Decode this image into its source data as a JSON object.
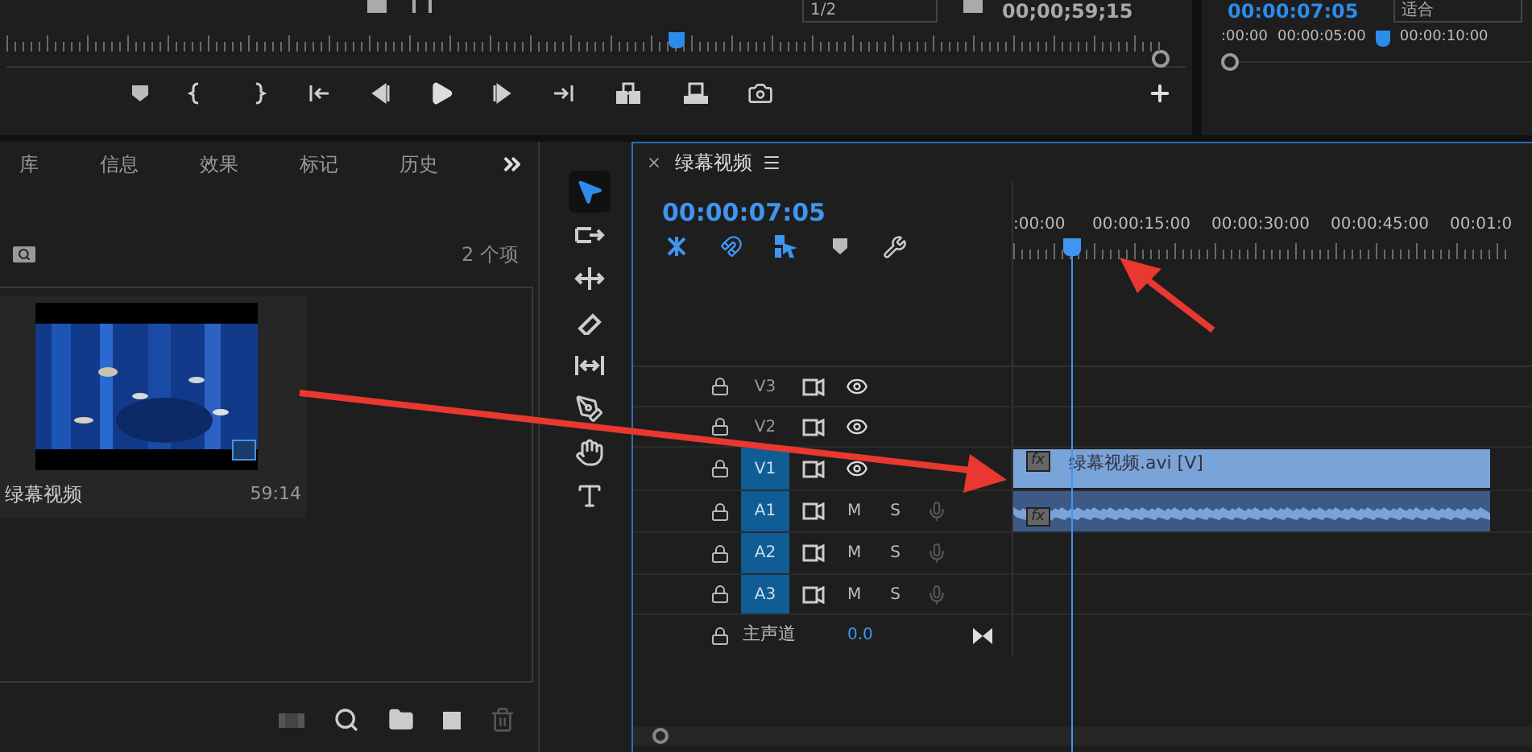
{
  "program_monitor": {
    "scale_dropdown": "1/2",
    "timecode": "00;00;59;15"
  },
  "source_monitor": {
    "timecode": "00:00:07:05",
    "fit_dropdown": "适合",
    "ruler_labels": [
      ":00:00",
      "00:00:05:00",
      "00:00:10:00"
    ]
  },
  "project_panel": {
    "tabs": [
      {
        "label": "库",
        "selected": false
      },
      {
        "label": "信息",
        "selected": false
      },
      {
        "label": "效果",
        "selected": false
      },
      {
        "label": "标记",
        "selected": false
      },
      {
        "label": "历史",
        "selected": false
      }
    ],
    "item_count": "2 个项",
    "clip": {
      "kind": "picture",
      "name": "绿幕视频",
      "duration": "59:14"
    }
  },
  "timeline": {
    "title": "绿幕视频",
    "timecode": "00:00:07:05",
    "ruler_labels": [
      ":00:00",
      "00:00:15:00",
      "00:00:30:00",
      "00:00:45:00",
      "00:01:0"
    ],
    "tracks": [
      {
        "kind": "video",
        "name": "V3",
        "targeted": false
      },
      {
        "kind": "video",
        "name": "V2",
        "targeted": false
      },
      {
        "kind": "video",
        "name": "V1",
        "targeted": true,
        "clip": {
          "kind": "video",
          "badge": "fx",
          "label": "绿幕视频.avi [V]"
        }
      },
      {
        "kind": "audio",
        "name": "A1",
        "targeted": true,
        "mute": "M",
        "solo": "S",
        "clip": {
          "kind": "audio",
          "badge": "fx"
        }
      },
      {
        "kind": "audio",
        "name": "A2",
        "targeted": true,
        "mute": "M",
        "solo": "S"
      },
      {
        "kind": "audio",
        "name": "A3",
        "targeted": true,
        "mute": "M",
        "solo": "S"
      }
    ],
    "master": {
      "label": "主声道",
      "value": "0.0"
    }
  }
}
